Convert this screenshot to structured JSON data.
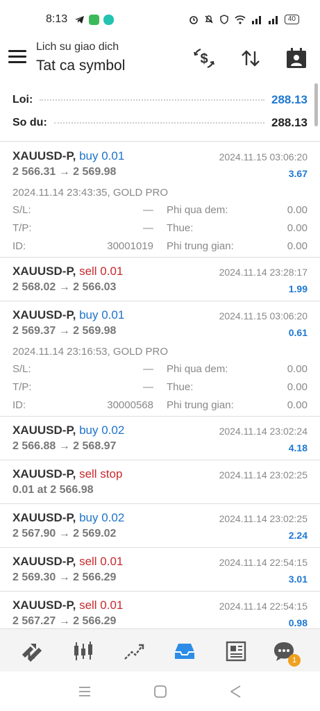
{
  "status_bar": {
    "time": "8:13",
    "battery": "40"
  },
  "header": {
    "subtitle": "Lich su giao dich",
    "title": "Tat ca symbol"
  },
  "summary": {
    "profit_label": "Loi:",
    "profit_value": "288.13",
    "balance_label": "So du:",
    "balance_value": "288.13"
  },
  "labels": {
    "sl": "S/L:",
    "tp": "T/P:",
    "id": "ID:",
    "swap": "Phi qua dem:",
    "tax": "Thue:",
    "commission": "Phi trung gian:"
  },
  "deals": [
    {
      "symbol": "XAUUSD-P,",
      "side": "buy 0.01",
      "side_type": "buy",
      "time": "2024.11.15 03:06:20",
      "price": "2 566.31 → 2 569.98",
      "profit": "3.67",
      "expanded": true,
      "open_info": "2024.11.14 23:43:35, GOLD PRO",
      "sl": "—",
      "tp": "—",
      "id": "30001019",
      "swap": "0.00",
      "tax": "0.00",
      "commission": "0.00"
    },
    {
      "symbol": "XAUUSD-P,",
      "side": "sell 0.01",
      "side_type": "sell",
      "time": "2024.11.14 23:28:17",
      "price": "2 568.02 → 2 566.03",
      "profit": "1.99"
    },
    {
      "symbol": "XAUUSD-P,",
      "side": "buy 0.01",
      "side_type": "buy",
      "time": "2024.11.15 03:06:20",
      "price": "2 569.37 → 2 569.98",
      "profit": "0.61",
      "expanded": true,
      "open_info": "2024.11.14 23:16:53, GOLD PRO",
      "sl": "—",
      "tp": "—",
      "id": "30000568",
      "swap": "0.00",
      "tax": "0.00",
      "commission": "0.00"
    },
    {
      "symbol": "XAUUSD-P,",
      "side": "buy 0.02",
      "side_type": "buy",
      "time": "2024.11.14 23:02:24",
      "price": "2 566.88 → 2 568.97",
      "profit": "4.18"
    },
    {
      "symbol": "XAUUSD-P,",
      "side": "sell stop",
      "side_type": "sell",
      "time": "2024.11.14 23:02:25",
      "price": "0.01 at 2 566.98",
      "profit": ""
    },
    {
      "symbol": "XAUUSD-P,",
      "side": "buy 0.02",
      "side_type": "buy",
      "time": "2024.11.14 23:02:25",
      "price": "2 567.90 → 2 569.02",
      "profit": "2.24"
    },
    {
      "symbol": "XAUUSD-P,",
      "side": "sell 0.01",
      "side_type": "sell",
      "time": "2024.11.14 22:54:15",
      "price": "2 569.30 → 2 566.29",
      "profit": "3.01"
    },
    {
      "symbol": "XAUUSD-P,",
      "side": "sell 0.01",
      "side_type": "sell",
      "time": "2024.11.14 22:54:15",
      "price": "2 567.27 → 2 566.29",
      "profit": "0.98"
    }
  ],
  "bottom_nav": {
    "items": [
      "quotes-icon",
      "chart-icon",
      "trade-icon",
      "history-icon",
      "news-icon",
      "messages-icon"
    ],
    "active": "history-icon",
    "messages_badge": "1"
  },
  "colors": {
    "buy": "#1e73c8",
    "sell": "#c8282d",
    "profit_blue": "#1e78d2",
    "active_nav": "#2d8de6"
  }
}
